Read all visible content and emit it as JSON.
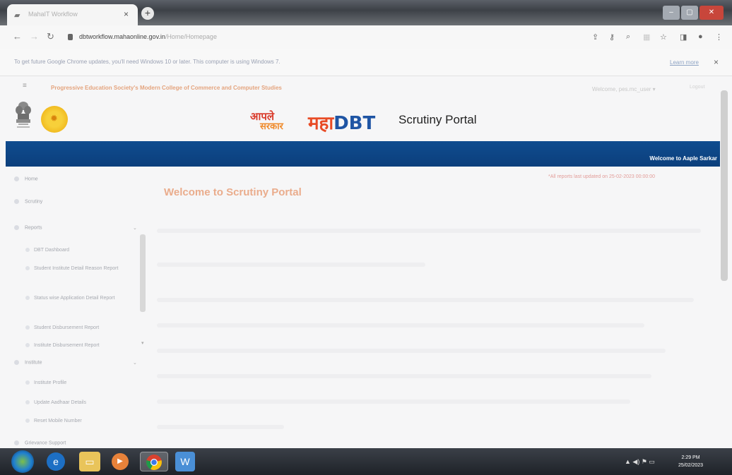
{
  "browser": {
    "tab_title": "MahaIT Workflow",
    "tab_close": "×",
    "new_tab": "+",
    "url_host": "dbtworkflow.mahaonline.gov.in",
    "url_path": "/Home/Homepage",
    "info_message": "To get future Google Chrome updates, you'll need Windows 10 or later. This computer is using Windows 7.",
    "info_link": "Learn more",
    "info_close": "×"
  },
  "topbar": {
    "menu_icon": "≡",
    "college": "Progressive Education Society's Modern College of Commerce and Computer Studies",
    "user": "Welcome, pes.mc_user ▾",
    "logout": "Logout"
  },
  "header": {
    "aaple_line1": "आपले",
    "aaple_line2": "सरकार",
    "maha_part1": "महा",
    "maha_part2": "DBT",
    "portal_title": "Scrutiny Portal"
  },
  "bluebar": {
    "welcome": "Welcome to Aaple Sarkar"
  },
  "sidebar": {
    "home": "Home",
    "scrutiny": "Scrutiny",
    "reports": "Reports",
    "report_items": [
      "DBT Dashboard",
      "Student Institute Detail Reason Report",
      "Status wise Application Detail Report",
      "Student Disbursement Report",
      "Institute Disbursement Report"
    ],
    "institute": "Institute",
    "institute_items": [
      "Institute Profile",
      "Update Aadhaar Details",
      "Reset Mobile Number"
    ],
    "support": "Grievance Support"
  },
  "main": {
    "update_note": "*All reports last updated on 25-02-2023 00:00:00",
    "welcome": "Welcome to Scrutiny Portal"
  },
  "taskbar": {
    "time": "2:29 PM",
    "date": "25/02/2023"
  },
  "colors": {
    "brand_blue": "#0f4c8f",
    "brand_orange": "#e84b25",
    "college_text": "#e4a47e"
  }
}
